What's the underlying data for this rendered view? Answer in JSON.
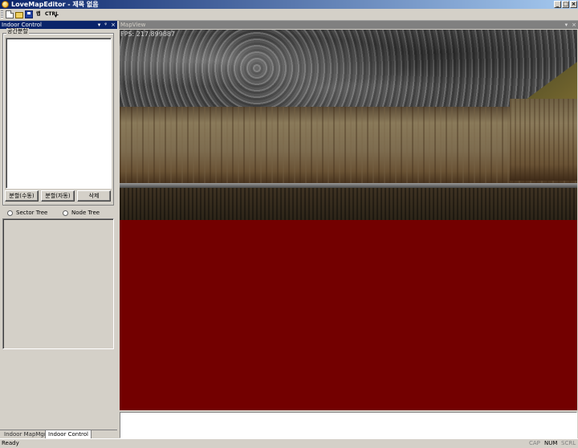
{
  "window": {
    "title": "LoveMapEditor - 제목 없음",
    "app_icon": "app-globe-icon",
    "buttons": {
      "minimize": "_",
      "maximize": "□",
      "close": "×"
    }
  },
  "toolbar": {
    "items": [
      "new-file-icon",
      "open-folder-icon",
      "save-disk-icon"
    ],
    "text_btn_1": "랩",
    "text_btn_2": "CTRL",
    "dropdown": "▾"
  },
  "left_pane": {
    "title": "Indoor Control",
    "pin": "▾",
    "dock": "ᵠ",
    "close": "×",
    "group_label": "공간분할",
    "buttons": {
      "manual": "분할(수동)",
      "auto": "분할(자동)",
      "delete": "삭제"
    },
    "radios": {
      "sector": "Sector Tree",
      "node": "Node Tree"
    },
    "tabs": {
      "mapmgr": "Indoor MapMgr",
      "indoor": "Indoor Control"
    }
  },
  "map_view": {
    "title": "MapView",
    "pin": "▾",
    "close": "×",
    "fps": "FPS: 217.899887"
  },
  "colors": {
    "title_bar": "#0a246a",
    "floor": "#730000",
    "panel": "#d4d0c8"
  },
  "status_bar": {
    "text": "Ready",
    "cap": "CAP",
    "num": "NUM",
    "scrl": "SCRL"
  }
}
